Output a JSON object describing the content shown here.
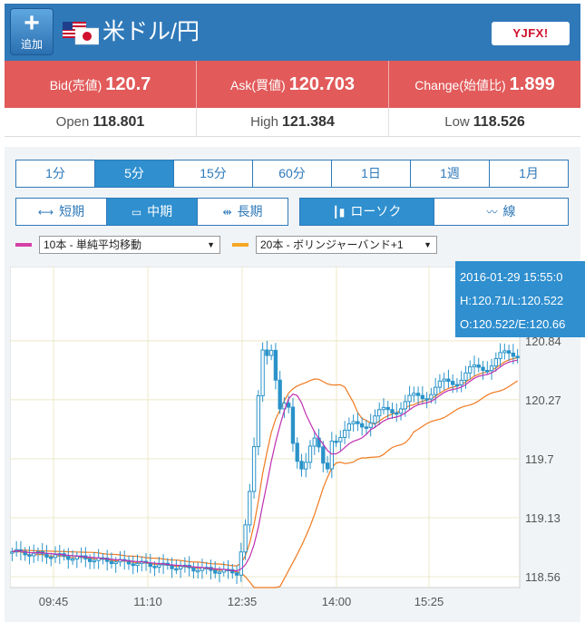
{
  "header": {
    "add_button": {
      "icon": "plus-icon",
      "label": "追加"
    },
    "flag_icon": "us-jp-flag-icon",
    "pair_title": "米ドル/円",
    "brand": "YJFX!"
  },
  "quotes": {
    "bid_label": "Bid(売値)",
    "bid_value": "120.7",
    "ask_label": "Ask(買値)",
    "ask_value": "120.703",
    "change_label": "Change(始値比)",
    "change_value": "1.899"
  },
  "ohl": {
    "open_label": "Open",
    "open_value": "118.801",
    "high_label": "High",
    "high_value": "121.384",
    "low_label": "Low",
    "low_value": "118.526"
  },
  "timeframes": [
    {
      "label": "1分",
      "active": false
    },
    {
      "label": "5分",
      "active": true
    },
    {
      "label": "15分",
      "active": false
    },
    {
      "label": "60分",
      "active": false
    },
    {
      "label": "1日",
      "active": false
    },
    {
      "label": "1週",
      "active": false
    },
    {
      "label": "1月",
      "active": false
    }
  ],
  "periods": [
    {
      "label": "短期",
      "icon": "short-term-icon",
      "active": false
    },
    {
      "label": "中期",
      "icon": "mid-term-icon",
      "active": true
    },
    {
      "label": "長期",
      "icon": "long-term-icon",
      "active": false
    }
  ],
  "chart_types": [
    {
      "label": "ローソク",
      "icon": "candlestick-icon",
      "active": true
    },
    {
      "label": "線",
      "icon": "line-chart-icon",
      "active": false
    }
  ],
  "indicators": {
    "ma": {
      "label": "10本 - 単純平均移動",
      "color": "#d63fa6"
    },
    "bb": {
      "label": "20本 - ボリンジャーバンド+1",
      "color": "#f5a623"
    }
  },
  "tooltip": {
    "line1": "2016-01-29 15:55:0",
    "line2": "H:120.71/L:120.522",
    "line3": "O:120.522/E:120.66"
  },
  "colors": {
    "accent": "#2f79b9",
    "quote_bg": "#e25a5a",
    "candle": "#2a93c9",
    "bb": "#f07a20",
    "ma": "#c030b0"
  },
  "chart_data": {
    "type": "candlestick",
    "x_ticks": [
      "09:45",
      "11:10",
      "12:35",
      "14:00",
      "15:25"
    ],
    "y_ticks": [
      "118.56",
      "119.13",
      "119.7",
      "120.27",
      "120.84"
    ],
    "ylim": [
      118.56,
      121.4
    ],
    "grid": true
  }
}
